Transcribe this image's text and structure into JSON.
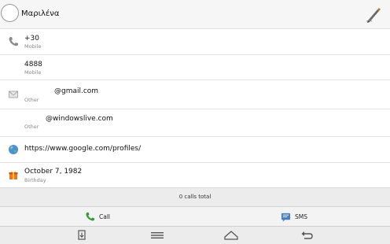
{
  "header": {
    "title": "Μαριλένα"
  },
  "phones": [
    {
      "value": "+30",
      "type": "Mobile"
    },
    {
      "value": "4888",
      "type": "Mobile"
    }
  ],
  "emails": [
    {
      "value": "@gmail.com",
      "type": "Other"
    },
    {
      "value": "@windowslive.com",
      "type": "Other"
    }
  ],
  "website": {
    "value": "https://www.google.com/profiles/"
  },
  "birthday": {
    "value": "October 7, 1982",
    "type": "Birthday"
  },
  "calls": {
    "total_label": "0 calls total"
  },
  "actions": {
    "call_label": "Call",
    "sms_label": "SMS"
  },
  "icons": {
    "phone": "phone-icon",
    "email": "envelope-icon",
    "web": "globe-icon",
    "birthday": "gift-icon",
    "edit": "pencil-icon",
    "call": "phone-icon",
    "sms": "sms-icon",
    "nav": [
      "screenshot-icon",
      "menu-icon",
      "home-icon",
      "back-icon"
    ]
  }
}
